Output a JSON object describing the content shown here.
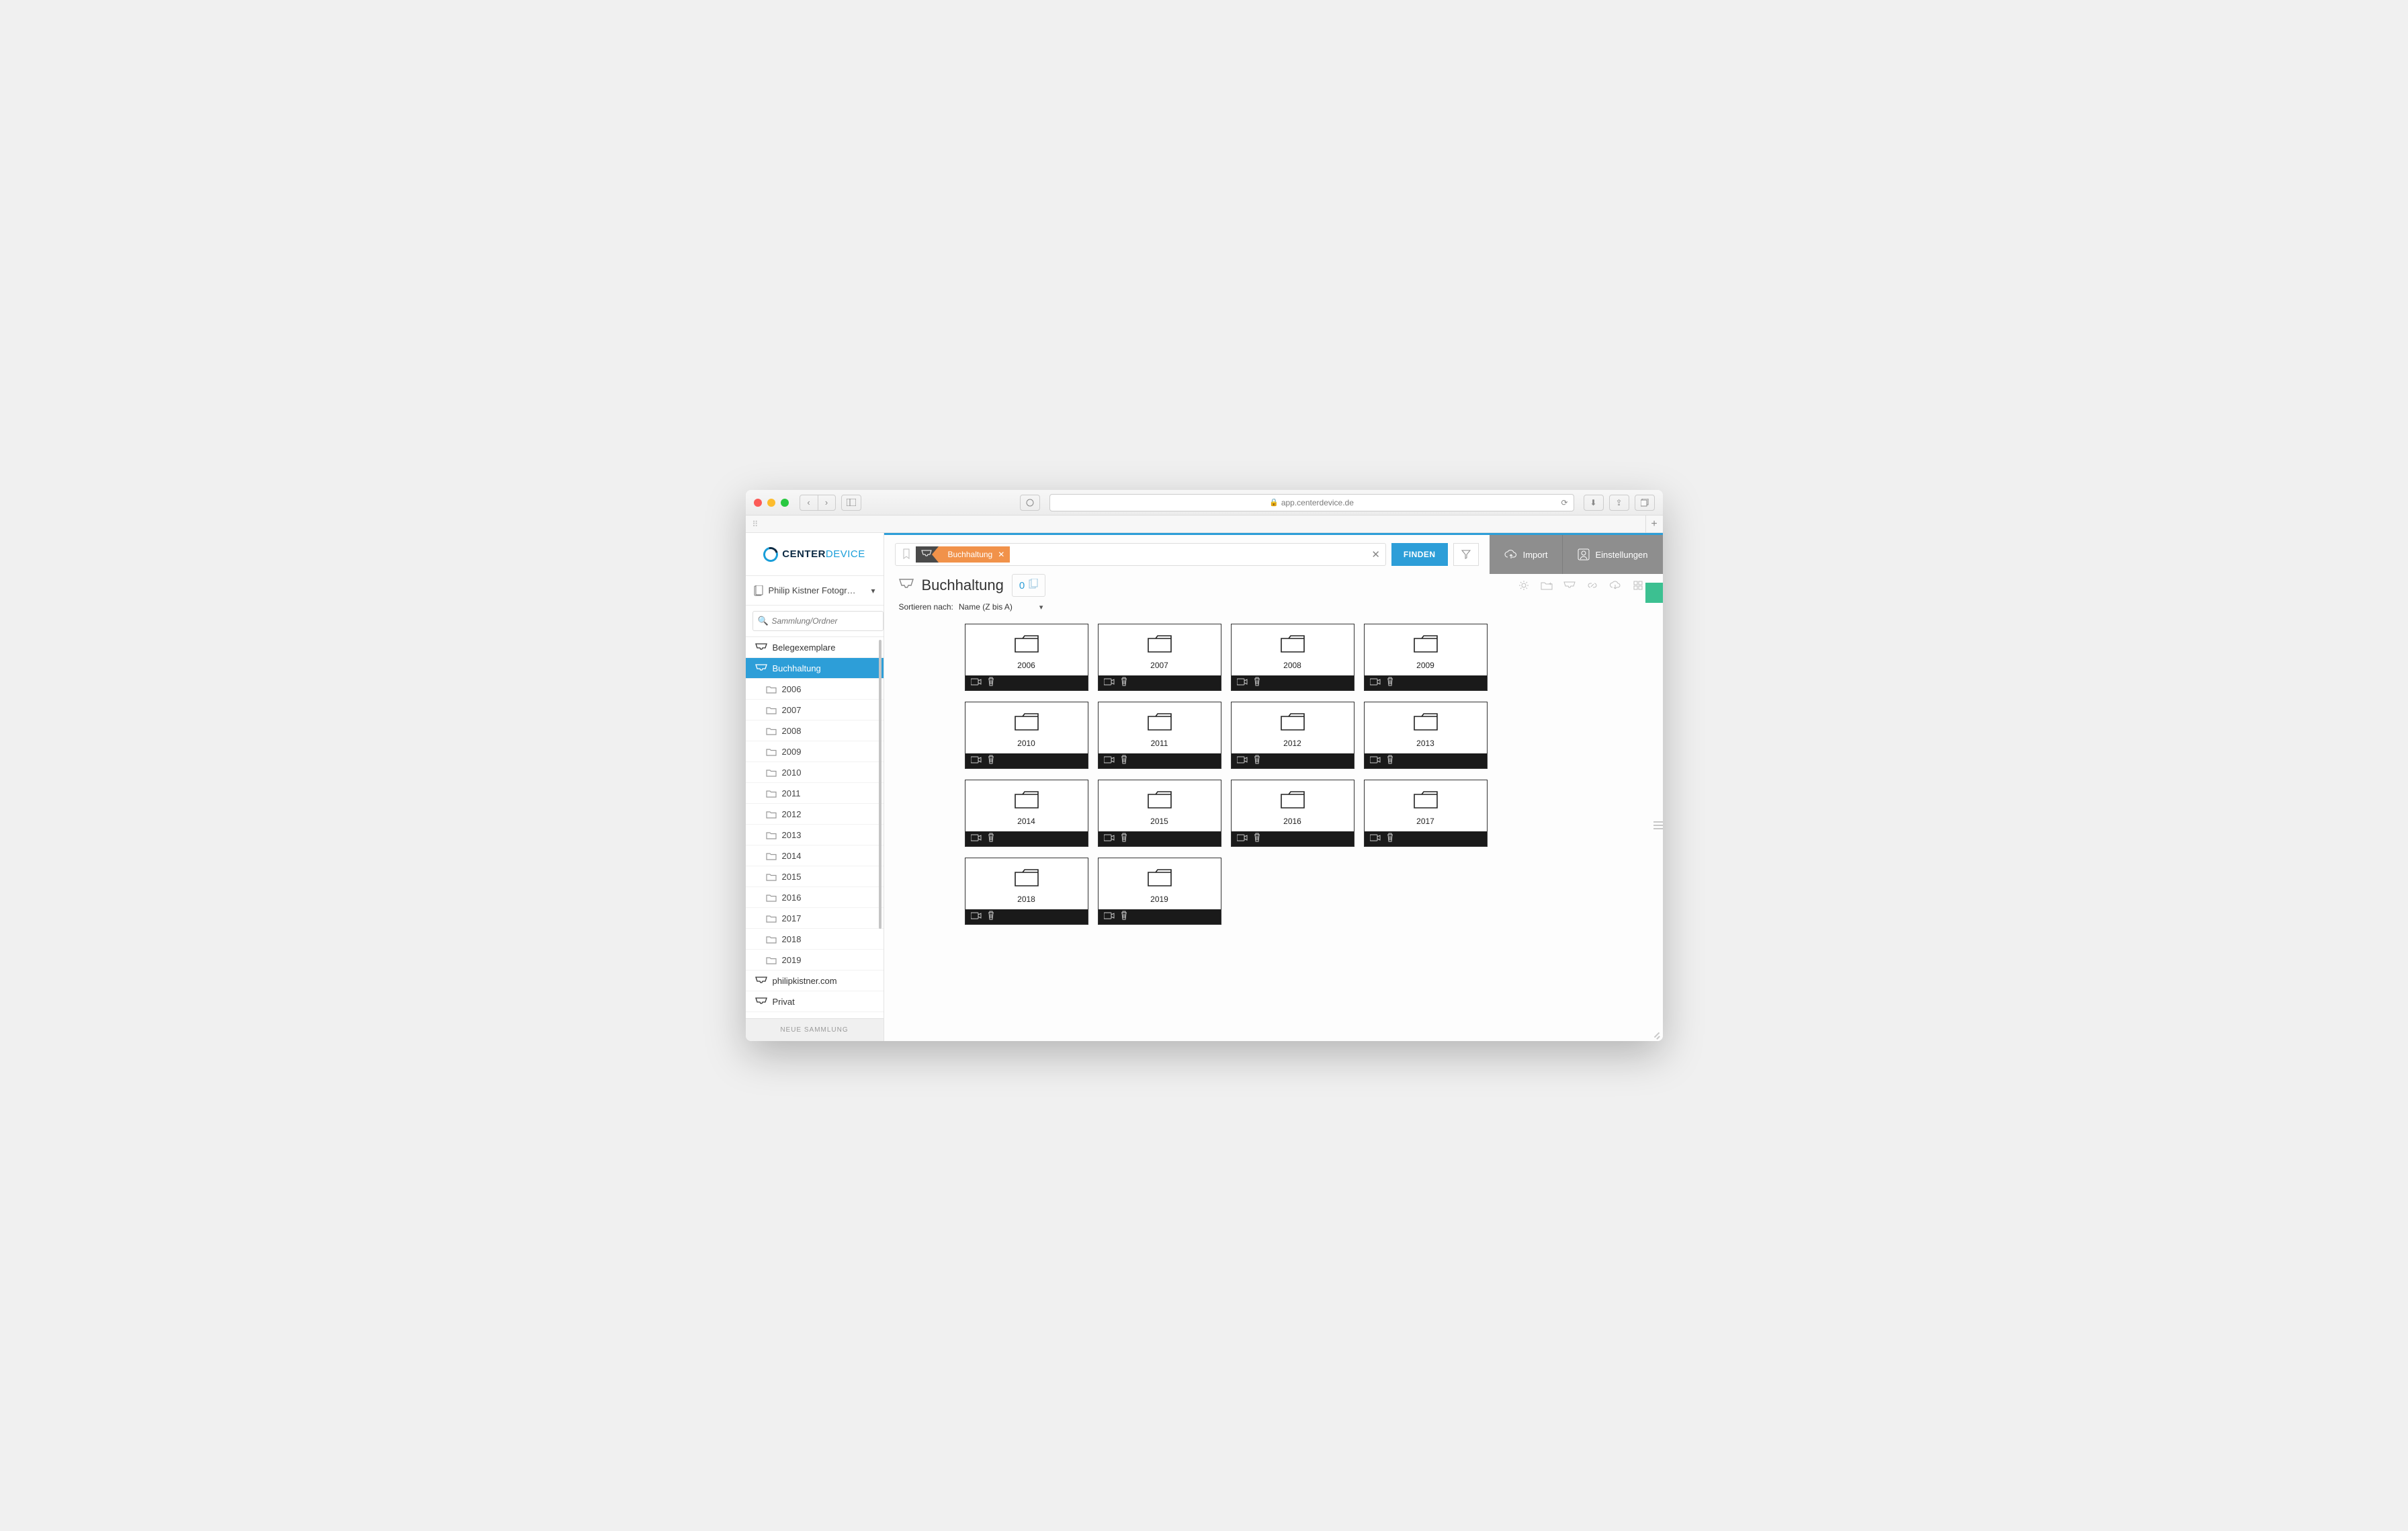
{
  "browser": {
    "url": "app.centerdevice.de"
  },
  "brand": {
    "part1": "CENTER",
    "part2": "DEVICE"
  },
  "workspace": {
    "name": "Philip Kistner Fotogr…"
  },
  "sidebar": {
    "search_placeholder": "Sammlung/Ordner",
    "items": [
      {
        "label": "Belegexemplare",
        "type": "collection"
      },
      {
        "label": "Buchhaltung",
        "type": "collection",
        "active": true
      },
      {
        "label": "2006",
        "type": "folder"
      },
      {
        "label": "2007",
        "type": "folder"
      },
      {
        "label": "2008",
        "type": "folder"
      },
      {
        "label": "2009",
        "type": "folder"
      },
      {
        "label": "2010",
        "type": "folder"
      },
      {
        "label": "2011",
        "type": "folder"
      },
      {
        "label": "2012",
        "type": "folder"
      },
      {
        "label": "2013",
        "type": "folder"
      },
      {
        "label": "2014",
        "type": "folder"
      },
      {
        "label": "2015",
        "type": "folder"
      },
      {
        "label": "2016",
        "type": "folder"
      },
      {
        "label": "2017",
        "type": "folder"
      },
      {
        "label": "2018",
        "type": "folder"
      },
      {
        "label": "2019",
        "type": "folder"
      },
      {
        "label": "philipkistner.com",
        "type": "collection"
      },
      {
        "label": "Privat",
        "type": "collection"
      }
    ],
    "new_collection": "NEUE SAMMLUNG"
  },
  "search": {
    "tag_prefix": "",
    "tag": "Buchhaltung",
    "find": "FINDEN"
  },
  "header": {
    "import": "Import",
    "settings": "Einstellungen"
  },
  "page": {
    "title": "Buchhaltung",
    "doc_count": "0",
    "sort_label": "Sortieren nach:",
    "sort_value": "Name (Z bis A)"
  },
  "folders": [
    {
      "name": "2006"
    },
    {
      "name": "2007"
    },
    {
      "name": "2008"
    },
    {
      "name": "2009"
    },
    {
      "name": "2010"
    },
    {
      "name": "2011"
    },
    {
      "name": "2012"
    },
    {
      "name": "2013"
    },
    {
      "name": "2014"
    },
    {
      "name": "2015"
    },
    {
      "name": "2016"
    },
    {
      "name": "2017"
    },
    {
      "name": "2018"
    },
    {
      "name": "2019"
    }
  ]
}
